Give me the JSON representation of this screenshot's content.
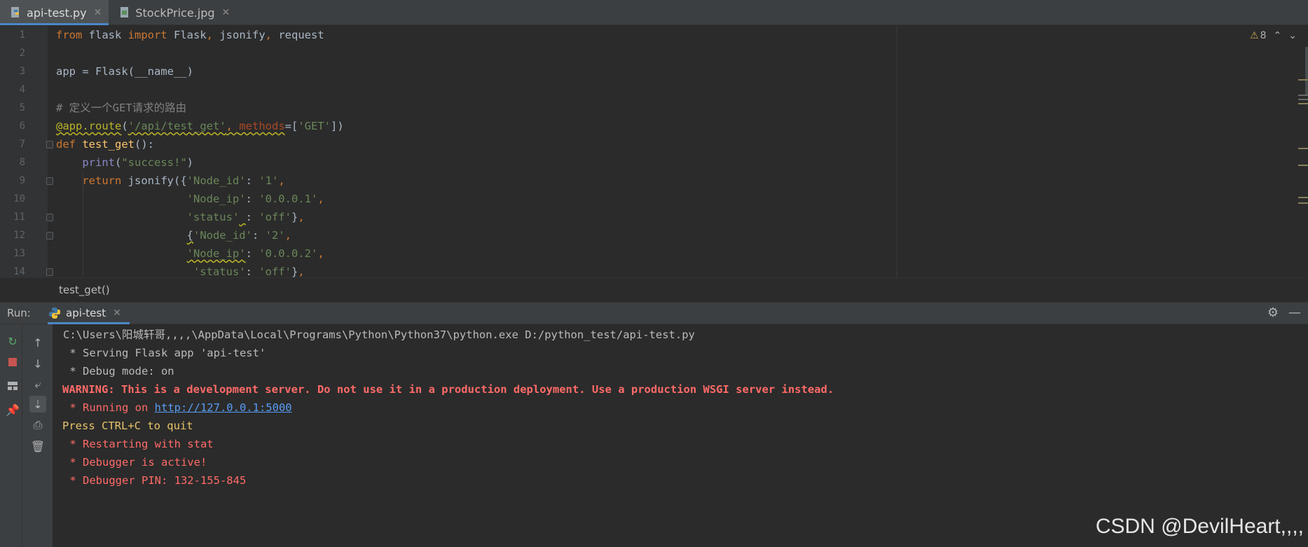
{
  "tabs": [
    {
      "label": "api-test.py",
      "icon": "python-file-icon",
      "active": true
    },
    {
      "label": "StockPrice.jpg",
      "icon": "image-file-icon",
      "active": false
    }
  ],
  "editor": {
    "inspections_count": "8",
    "lines": [
      "1",
      "2",
      "3",
      "4",
      "5",
      "6",
      "7",
      "8",
      "9",
      "10",
      "11",
      "12",
      "13",
      "14"
    ]
  },
  "breadcrumb": "test_get()",
  "run": {
    "label": "Run:",
    "tab_label": "api-test"
  },
  "console": {
    "line1": "C:\\Users\\阳城轩哥,,,,\\AppData\\Local\\Programs\\Python\\Python37\\python.exe D:/python_test/api-test.py",
    "line2": " * Serving Flask app 'api-test'",
    "line3": " * Debug mode: on",
    "line4": "WARNING: This is a development server. Do not use it in a production deployment. Use a production WSGI server instead.",
    "line5_prefix": " * Running on ",
    "line5_link": "http://127.0.0.1:5000",
    "line6": "Press CTRL+C to quit",
    "line7": " * Restarting with stat",
    "line8": " * Debugger is active!",
    "line9": " * Debugger PIN: 132-155-845"
  },
  "watermark": "CSDN @DevilHeart,,,,",
  "colors": {
    "background": "#2b2b2b",
    "keyword": "#cc7832",
    "string": "#6a8759",
    "error": "#ff6b68",
    "link": "#589df6",
    "accent": "#4a88c7"
  }
}
